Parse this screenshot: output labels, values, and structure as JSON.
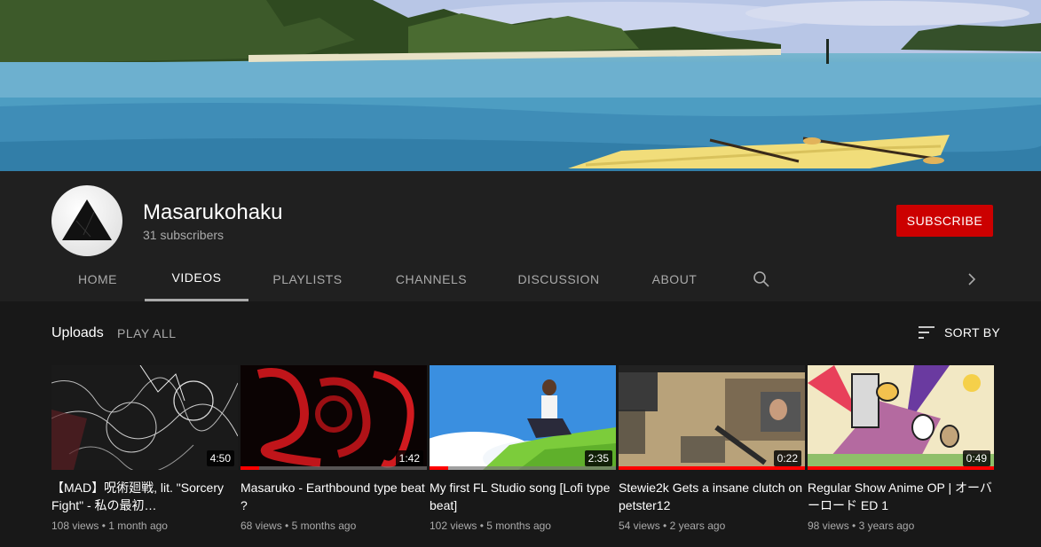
{
  "channel": {
    "name": "Masarukohaku",
    "subscribers": "31 subscribers",
    "subscribe_label": "SUBSCRIBE"
  },
  "tabs": [
    {
      "label": "HOME"
    },
    {
      "label": "VIDEOS"
    },
    {
      "label": "PLAYLISTS"
    },
    {
      "label": "CHANNELS"
    },
    {
      "label": "DISCUSSION"
    },
    {
      "label": "ABOUT"
    }
  ],
  "active_tab": "VIDEOS",
  "icons": {
    "search": "search-icon",
    "next": "chevron-right-icon",
    "sort": "sort-icon"
  },
  "section": {
    "title": "Uploads",
    "play_all": "PLAY ALL",
    "sort_by": "SORT BY"
  },
  "colors": {
    "subscribe": "#cc0000",
    "progress": "#ff0000",
    "background": "#181818",
    "header": "#202020"
  },
  "videos": [
    {
      "title": "【MAD】呪術廻戦, lit. \"Sorcery Fight\" - 私の最初…",
      "views": "108 views",
      "age": "1 month ago",
      "duration": "4:50",
      "watched": 0
    },
    {
      "title": "Masaruko - Earthbound type beat ?",
      "views": "68 views",
      "age": "5 months ago",
      "duration": "1:42",
      "watched": 0.1
    },
    {
      "title": "My first FL Studio song [Lofi type beat]",
      "views": "102 views",
      "age": "5 months ago",
      "duration": "2:35",
      "watched": 0.1
    },
    {
      "title": "Stewie2k Gets a insane clutch on petster12",
      "views": "54 views",
      "age": "2 years ago",
      "duration": "0:22",
      "watched": 1
    },
    {
      "title": "Regular Show Anime OP | オーバーロード ED 1",
      "views": "98 views",
      "age": "3 years ago",
      "duration": "0:49",
      "watched": 1
    }
  ]
}
